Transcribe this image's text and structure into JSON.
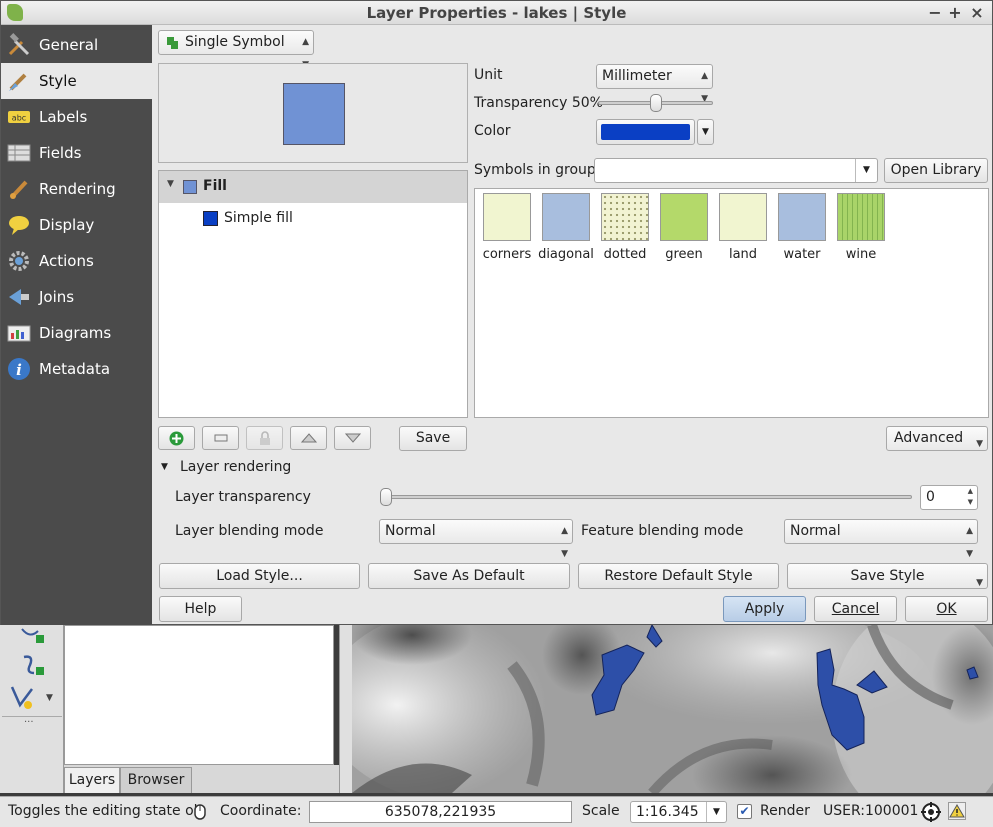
{
  "window": {
    "title": "Layer Properties - lakes | Style",
    "minimize": "−",
    "maximize": "+",
    "close": "×"
  },
  "sidebar": {
    "items": [
      {
        "label": "General",
        "icon": "tools-icon"
      },
      {
        "label": "Style",
        "icon": "paintbrush-icon"
      },
      {
        "label": "Labels",
        "icon": "abc-label-icon"
      },
      {
        "label": "Fields",
        "icon": "table-icon"
      },
      {
        "label": "Rendering",
        "icon": "brush-icon"
      },
      {
        "label": "Display",
        "icon": "speech-bubble-icon"
      },
      {
        "label": "Actions",
        "icon": "gear-icon"
      },
      {
        "label": "Joins",
        "icon": "join-icon"
      },
      {
        "label": "Diagrams",
        "icon": "diagram-icon"
      },
      {
        "label": "Metadata",
        "icon": "info-icon"
      }
    ]
  },
  "renderer": {
    "value": "Single Symbol"
  },
  "tree": {
    "fill_label": "Fill",
    "simple_fill_label": "Simple fill"
  },
  "props": {
    "unit_label": "Unit",
    "unit_value": "Millimeter",
    "transparency_label": "Transparency 50%",
    "transparency_value": 0.5,
    "color_label": "Color",
    "color_value": "#0a3fc4"
  },
  "symbols": {
    "group_label": "Symbols in group",
    "group_value": "",
    "open_library": "Open Library",
    "items": [
      {
        "name": "corners",
        "color": "#f1f5d0"
      },
      {
        "name": "diagonal",
        "color": "#a8bede"
      },
      {
        "name": "dotted",
        "color": "#f2f3d2"
      },
      {
        "name": "green",
        "color": "#b4d96a"
      },
      {
        "name": "land",
        "color": "#f1f5d0"
      },
      {
        "name": "water",
        "color": "#a8bede"
      },
      {
        "name": "wine",
        "color": "#a9d469"
      }
    ]
  },
  "layer_buttons": {
    "save": "Save",
    "advanced": "Advanced"
  },
  "layer_rendering": {
    "header": "Layer rendering",
    "transparency_label": "Layer transparency",
    "transparency_value": "0",
    "blending_label": "Layer blending mode",
    "blending_value": "Normal",
    "feature_blending_label": "Feature blending mode",
    "feature_blending_value": "Normal"
  },
  "actions": {
    "load_style": "Load Style...",
    "save_default": "Save As Default",
    "restore_default": "Restore Default Style",
    "save_style": "Save Style",
    "help": "Help",
    "apply": "Apply",
    "cancel": "Cancel",
    "ok": "OK"
  },
  "dock": {
    "tab_layers": "Layers",
    "tab_browser": "Browser",
    "more": "···"
  },
  "statusbar": {
    "message": "Toggles the editing state ol",
    "coordinate_label": "Coordinate:",
    "coordinate_value": "635078,221935",
    "scale_label": "Scale",
    "scale_value": "1:16.345",
    "render_label": "Render",
    "crs": "USER:100001"
  }
}
